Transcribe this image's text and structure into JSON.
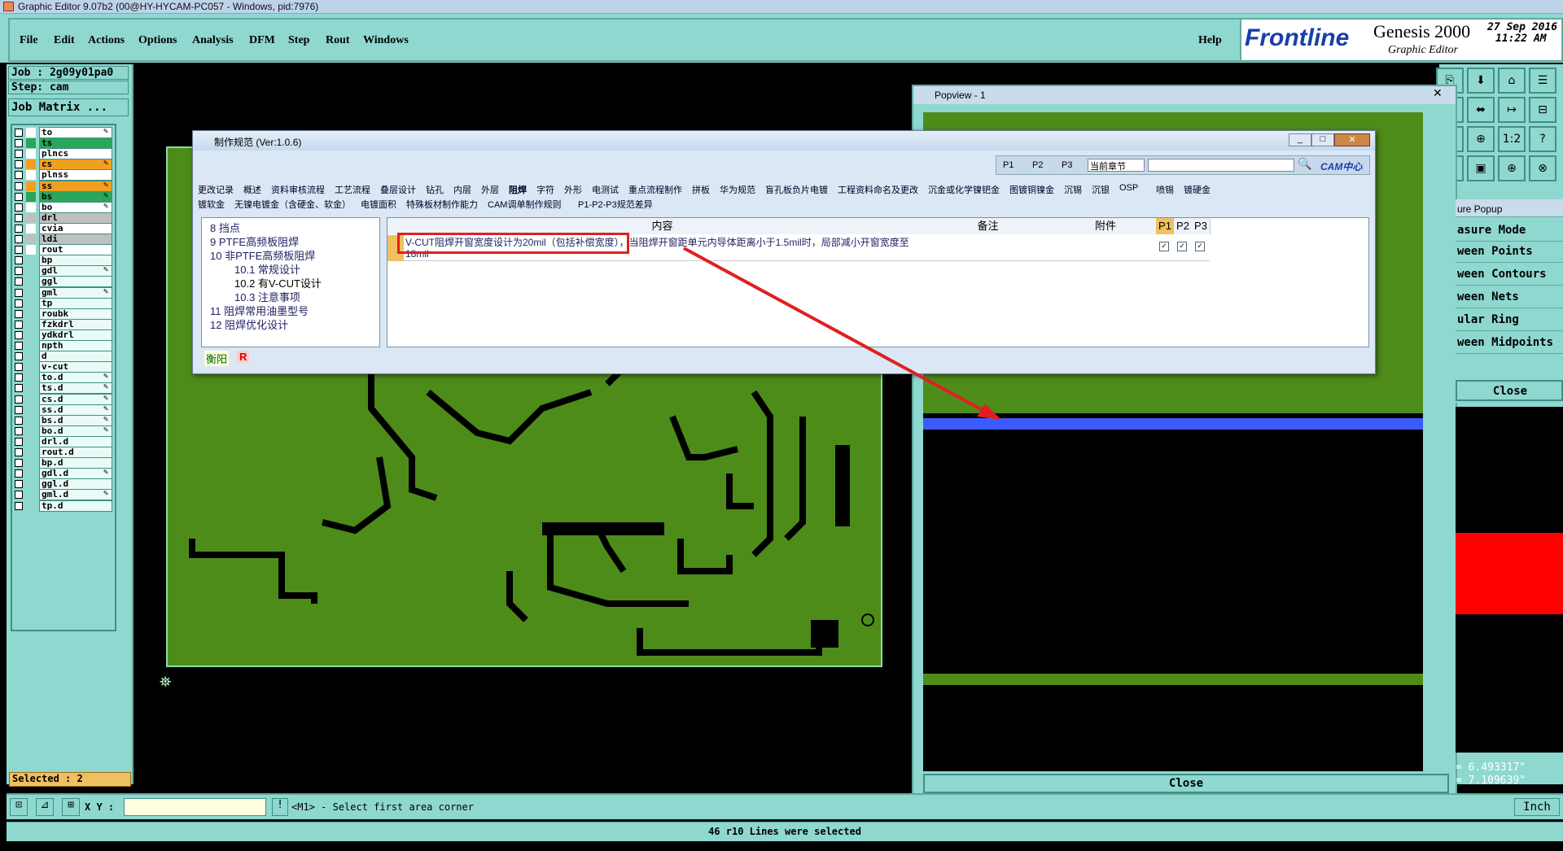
{
  "window": {
    "title": "Graphic Editor 9.07b2 (00@HY-HYCAM-PC057 - Windows, pid:7976)"
  },
  "menu": {
    "items": [
      "File",
      "Edit",
      "Actions",
      "Options",
      "Analysis",
      "DFM",
      "Step",
      "Rout",
      "Windows"
    ],
    "help": "Help"
  },
  "brand": {
    "logo": "Frontline",
    "product": "Genesis 2000",
    "subtitle": "Graphic Editor",
    "date": "27 Sep 2016",
    "time": "11:22 AM"
  },
  "job": {
    "job": "Job : 2g09y01pa0",
    "step": "Step: cam",
    "matrix": "Job Matrix ..."
  },
  "layers": [
    {
      "name": "to",
      "color": "#ffffff",
      "edit": true
    },
    {
      "name": "ts",
      "color": "#2aa55a",
      "edit": false
    },
    {
      "name": "plncs",
      "color": "#ffffff",
      "edit": false
    },
    {
      "name": "cs",
      "color": "#f0a020",
      "edit": true
    },
    {
      "name": "plnss",
      "color": "#ffffff",
      "edit": false
    },
    {
      "name": "ss",
      "color": "#f0a020",
      "edit": true
    },
    {
      "name": "bs",
      "color": "#2aa55a",
      "edit": true
    },
    {
      "name": "bo",
      "color": "#ffffff",
      "edit": true
    },
    {
      "name": "drl",
      "color": "#c0c0c0",
      "edit": false
    },
    {
      "name": "cvia",
      "color": "#ffffff",
      "edit": false
    },
    {
      "name": "ldi",
      "color": "#c0c0c0",
      "edit": false
    },
    {
      "name": "rout",
      "color": "#ffffff",
      "edit": false
    },
    {
      "name": "bp",
      "color": "#8fd8cf",
      "edit": false
    },
    {
      "name": "gdl",
      "color": "#8fd8cf",
      "edit": true
    },
    {
      "name": "ggl",
      "color": "#8fd8cf",
      "edit": false
    },
    {
      "name": "gml",
      "color": "#8fd8cf",
      "edit": true
    },
    {
      "name": "tp",
      "color": "#8fd8cf",
      "edit": false
    },
    {
      "name": "roubk",
      "color": "#8fd8cf",
      "edit": false
    },
    {
      "name": "fzkdrl",
      "color": "#8fd8cf",
      "edit": false
    },
    {
      "name": "ydkdrl",
      "color": "#8fd8cf",
      "edit": false
    },
    {
      "name": "npth",
      "color": "#8fd8cf",
      "edit": false
    },
    {
      "name": "d",
      "color": "#8fd8cf",
      "edit": false
    },
    {
      "name": "v-cut",
      "color": "#8fd8cf",
      "edit": false
    },
    {
      "name": "to.d",
      "color": "#8fd8cf",
      "edit": true
    },
    {
      "name": "ts.d",
      "color": "#8fd8cf",
      "edit": true
    },
    {
      "name": "cs.d",
      "color": "#8fd8cf",
      "edit": true
    },
    {
      "name": "ss.d",
      "color": "#8fd8cf",
      "edit": true
    },
    {
      "name": "bs.d",
      "color": "#8fd8cf",
      "edit": true
    },
    {
      "name": "bo.d",
      "color": "#8fd8cf",
      "edit": true
    },
    {
      "name": "drl.d",
      "color": "#8fd8cf",
      "edit": false
    },
    {
      "name": "rout.d",
      "color": "#8fd8cf",
      "edit": false
    },
    {
      "name": "bp.d",
      "color": "#8fd8cf",
      "edit": false
    },
    {
      "name": "gdl.d",
      "color": "#8fd8cf",
      "edit": true
    },
    {
      "name": "ggl.d",
      "color": "#8fd8cf",
      "edit": false
    },
    {
      "name": "gml.d",
      "color": "#8fd8cf",
      "edit": true
    },
    {
      "name": "tp.d",
      "color": "#8fd8cf",
      "edit": false
    }
  ],
  "selected": "Selected : 2",
  "popview": {
    "title": "Popview - 1",
    "close": "Close"
  },
  "measure": {
    "title": "ure Popup",
    "items": [
      "asure Mode",
      "ween Points",
      "ween Contours",
      "ween Nets",
      "ular Ring",
      "ween Midpoints"
    ],
    "close": "Close",
    "coord1": "= 6.493317\"",
    "coord2": "= 7.109639\""
  },
  "dialog": {
    "title": "制作规范 (Ver:1.0.6)",
    "filters": [
      "P1",
      "P2",
      "P3"
    ],
    "chapter": "当前章节",
    "cam_logo": "CAM中心",
    "tabs_row1": [
      "更改记录",
      "概述",
      "资料审核流程",
      "工艺流程",
      "叠层设计",
      "钻孔",
      "内层",
      "外层",
      "阻焊",
      "字符",
      "外形",
      "电测试",
      "重点流程制作",
      "拼板",
      "华为规范",
      "盲孔板负片电镀",
      "工程资料命名及更改",
      "沉金或化学镍钯金",
      "图镀铜镍金",
      "沉锡",
      "沉银",
      "OSP",
      "喷锡",
      "镀硬金"
    ],
    "tabs_row2": [
      "镀软金",
      "无镍电镀金（含硬金、软金）",
      "电镀面积",
      "特殊板材制作能力",
      "CAM调单制作规则",
      "P1-P2-P3规范差异"
    ],
    "tree": [
      "8 挡点",
      "9 PTFE高频板阻焊",
      "10 非PTFE高频板阻焊",
      "10.1 常规设计",
      "10.2 有V-CUT设计",
      "10.3 注意事项",
      "11 阻焊常用油墨型号",
      "12 阻焊优化设计"
    ],
    "tree_footer": [
      "衡阳",
      "R"
    ],
    "headers": {
      "content": "内容",
      "note": "备注",
      "attach": "附件",
      "p1": "P1",
      "p2": "P2",
      "p3": "P3"
    },
    "row_content": "V-CUT阻焊开窗宽度设计为20mil（包括补偿宽度），当阻焊开窗距单元内导体距离小于1.5mil时，局部减小开窗宽度至18mil"
  },
  "cmd": {
    "xy": "X Y :",
    "prompt": "<M1> - Select first area corner",
    "units": "Inch"
  },
  "status": "46 r10 Lines were selected"
}
